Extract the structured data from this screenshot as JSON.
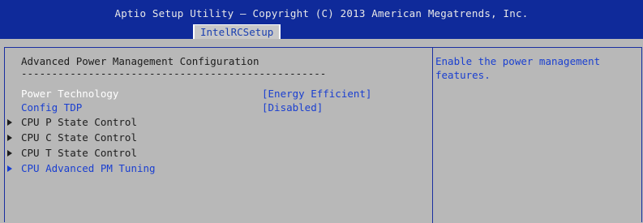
{
  "header": {
    "title": "Aptio Setup Utility – Copyright (C) 2013 American Megatrends, Inc.",
    "active_tab": "IntelRCSetup"
  },
  "main": {
    "section_title": "Advanced Power Management Configuration",
    "separator": "--------------------------------------------------",
    "settings": [
      {
        "label": "Power Technology",
        "value": "[Energy Efficient]"
      },
      {
        "label": "Config TDP",
        "value": "[Disabled]"
      }
    ],
    "submenus": [
      {
        "label": "CPU P State Control"
      },
      {
        "label": "CPU C State Control"
      },
      {
        "label": "CPU T State Control"
      },
      {
        "label": "CPU Advanced PM Tuning"
      }
    ]
  },
  "help": {
    "text": "Enable the power management features."
  },
  "colors": {
    "header_bg": "#0f2a9a",
    "body_bg": "#b8b8b8",
    "highlight": "#ffffff",
    "accent": "#1a3fd0"
  }
}
